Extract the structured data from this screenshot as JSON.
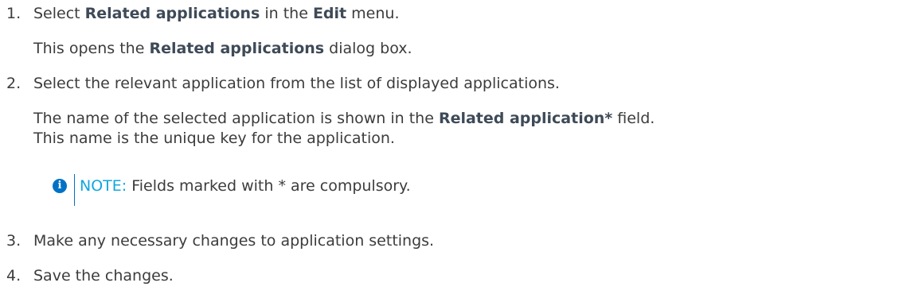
{
  "steps": [
    {
      "number": "1.",
      "pre": "Select ",
      "b1": "Related applications",
      "mid": " in the ",
      "b2": "Edit",
      "post": " menu.",
      "sub_pre": "This opens the ",
      "sub_bold": "Related applications",
      "sub_post": " dialog box."
    },
    {
      "number": "2.",
      "text": "Select the relevant application from the list of displayed applications.",
      "sub_pre": "The name of the selected application is shown in the ",
      "sub_bold": "Related application*",
      "sub_post": " field.",
      "sub_line2": "This name is the unique key for the application.",
      "note": {
        "icon": "info-icon",
        "icon_glyph": "i",
        "label": "NOTE:",
        "text": " Fields marked with * are compulsory."
      }
    },
    {
      "number": "3.",
      "text": "Make any necessary changes to application settings."
    },
    {
      "number": "4.",
      "text": "Save the changes."
    }
  ],
  "colors": {
    "text": "#3c3c3c",
    "bold": "#3e4a57",
    "note_icon": "#0072c6",
    "note_label": "#10a6e0"
  }
}
